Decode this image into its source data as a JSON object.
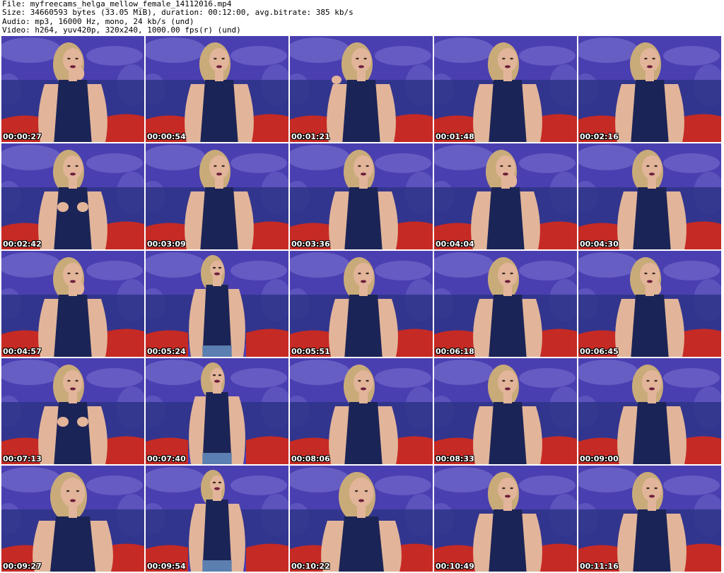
{
  "header": {
    "file_line": "File: myfreecams_helga_mellow_female_14112016.mp4",
    "size_line": "Size: 34660593 bytes (33.05 MiB), duration: 00:12:00, avg.bitrate: 385 kb/s",
    "audio_line": "Audio: mp3, 16000 Hz, mono, 24 kb/s (und)",
    "video_line": "Video: h264, yuv420p, 320x240, 1000.00 fps(r) (und)"
  },
  "colors": {
    "backdrop": "#4a3fb0",
    "backdrop_light": "#7f78d6",
    "curtain": "#2e3487",
    "couch": "#c62a24",
    "top": "#1b2456",
    "skin": "#e2b59a",
    "hair": "#c9ab7a"
  },
  "thumbnails": [
    {
      "timestamp": "00:00:27",
      "pose": "hand-face"
    },
    {
      "timestamp": "00:00:54",
      "pose": "lean"
    },
    {
      "timestamp": "00:01:21",
      "pose": "hair-flip"
    },
    {
      "timestamp": "00:01:48",
      "pose": "lean"
    },
    {
      "timestamp": "00:02:16",
      "pose": "upright"
    },
    {
      "timestamp": "00:02:42",
      "pose": "hands-chest"
    },
    {
      "timestamp": "00:03:09",
      "pose": "lean"
    },
    {
      "timestamp": "00:03:36",
      "pose": "lean"
    },
    {
      "timestamp": "00:04:04",
      "pose": "hand-face"
    },
    {
      "timestamp": "00:04:30",
      "pose": "lean"
    },
    {
      "timestamp": "00:04:57",
      "pose": "hand-face"
    },
    {
      "timestamp": "00:05:24",
      "pose": "far"
    },
    {
      "timestamp": "00:05:51",
      "pose": "lean"
    },
    {
      "timestamp": "00:06:18",
      "pose": "lean"
    },
    {
      "timestamp": "00:06:45",
      "pose": "hand-face"
    },
    {
      "timestamp": "00:07:13",
      "pose": "hands-chest"
    },
    {
      "timestamp": "00:07:40",
      "pose": "far"
    },
    {
      "timestamp": "00:08:06",
      "pose": "lean"
    },
    {
      "timestamp": "00:08:33",
      "pose": "lean"
    },
    {
      "timestamp": "00:09:00",
      "pose": "lean"
    },
    {
      "timestamp": "00:09:27",
      "pose": "close"
    },
    {
      "timestamp": "00:09:54",
      "pose": "far"
    },
    {
      "timestamp": "00:10:22",
      "pose": "close"
    },
    {
      "timestamp": "00:10:49",
      "pose": "lean"
    },
    {
      "timestamp": "00:11:16",
      "pose": "lean"
    }
  ]
}
